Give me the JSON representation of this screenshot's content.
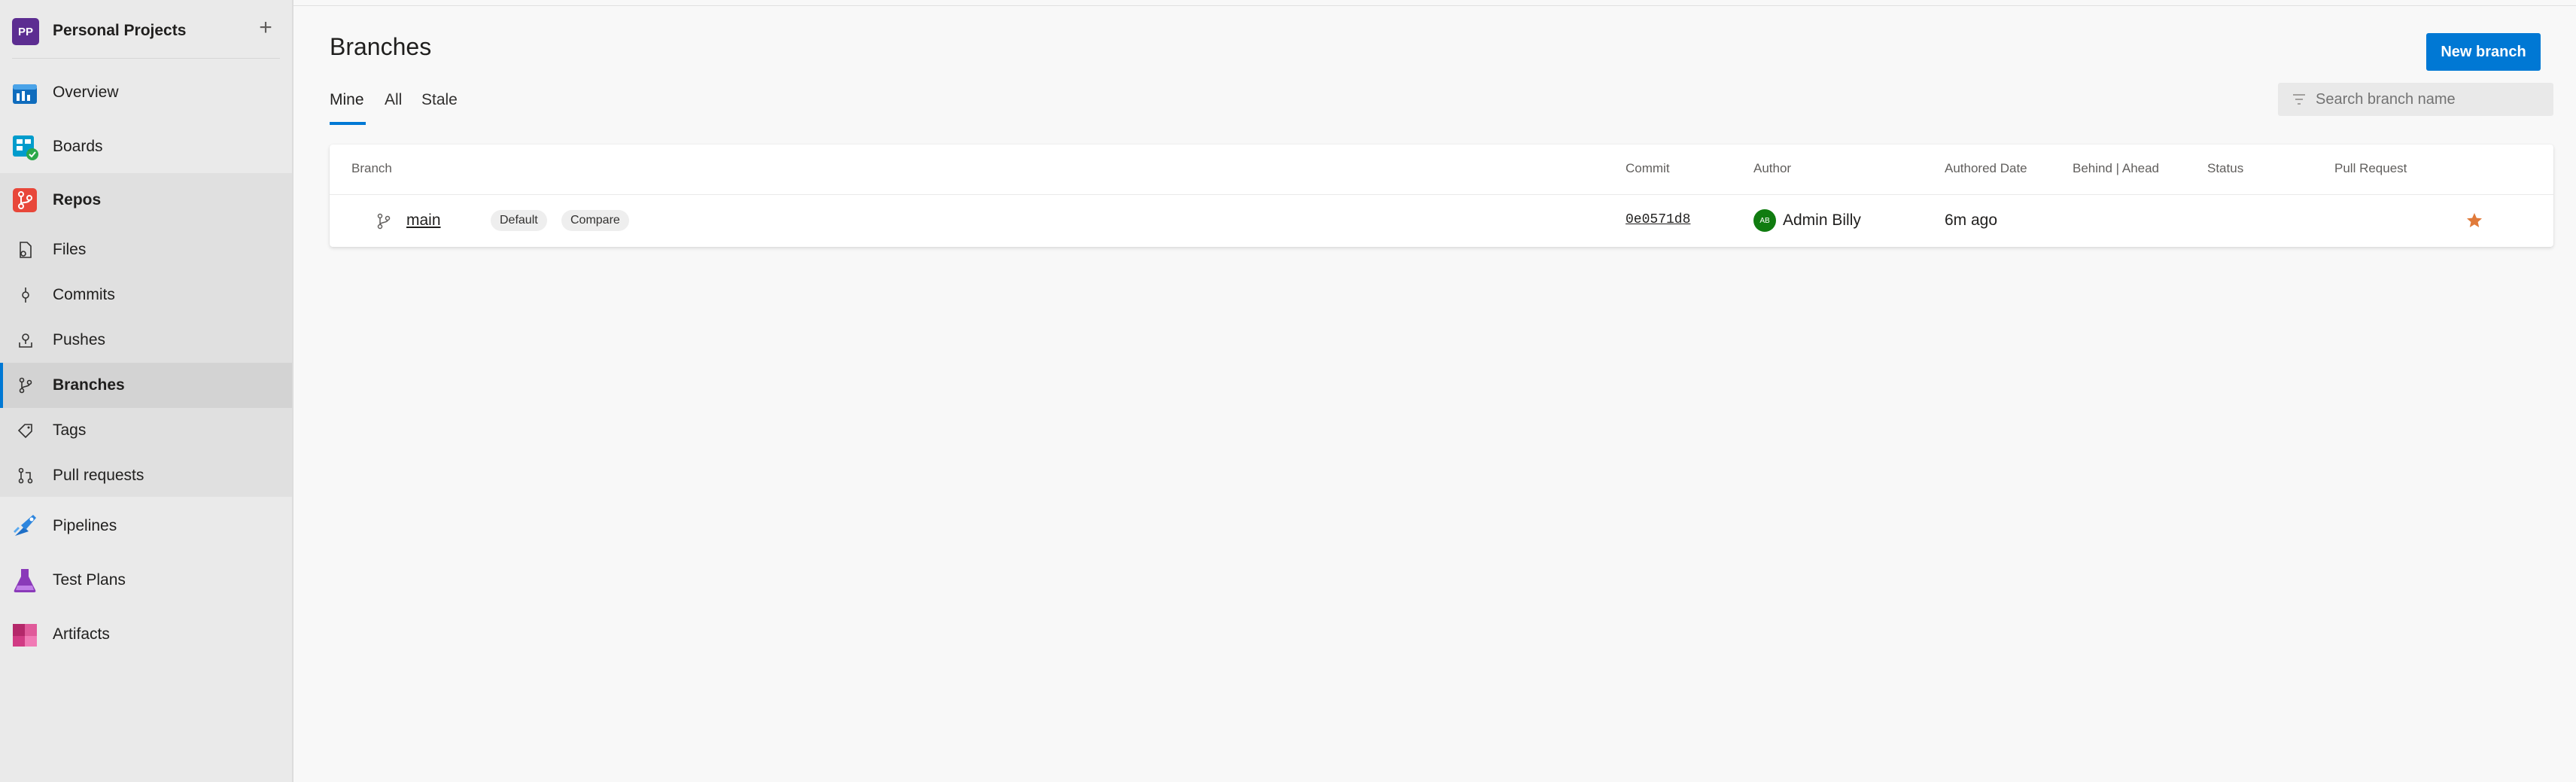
{
  "project": {
    "initials": "PP",
    "name": "Personal Projects",
    "add_symbol": "+"
  },
  "nav": {
    "overview": "Overview",
    "boards": "Boards",
    "repos": "Repos",
    "files": "Files",
    "commits": "Commits",
    "pushes": "Pushes",
    "branches": "Branches",
    "tags": "Tags",
    "pull_requests": "Pull requests",
    "pipelines": "Pipelines",
    "test_plans": "Test Plans",
    "artifacts": "Artifacts"
  },
  "page": {
    "title": "Branches",
    "new_branch_label": "New branch",
    "tabs": [
      "Mine",
      "All",
      "Stale"
    ],
    "active_tab": "Mine",
    "search_placeholder": "Search branch name"
  },
  "table": {
    "headers": {
      "branch": "Branch",
      "commit": "Commit",
      "author": "Author",
      "authored_date": "Authored Date",
      "behind_ahead": "Behind | Ahead",
      "status": "Status",
      "pull_request": "Pull Request"
    },
    "rows": [
      {
        "name": "main",
        "default_badge": "Default",
        "compare_badge": "Compare",
        "commit": "0e0571d8",
        "author_initials": "AB",
        "author": "Admin Billy",
        "authored_date": "6m ago"
      }
    ]
  },
  "colors": {
    "accent": "#0078d4",
    "project_avatar": "#5c2d91",
    "author_avatar": "#107c10",
    "favorite_star": "#e07a3a"
  },
  "icons": {
    "filter": "filter-icon",
    "branch": "branch-icon",
    "star": "star-icon"
  }
}
